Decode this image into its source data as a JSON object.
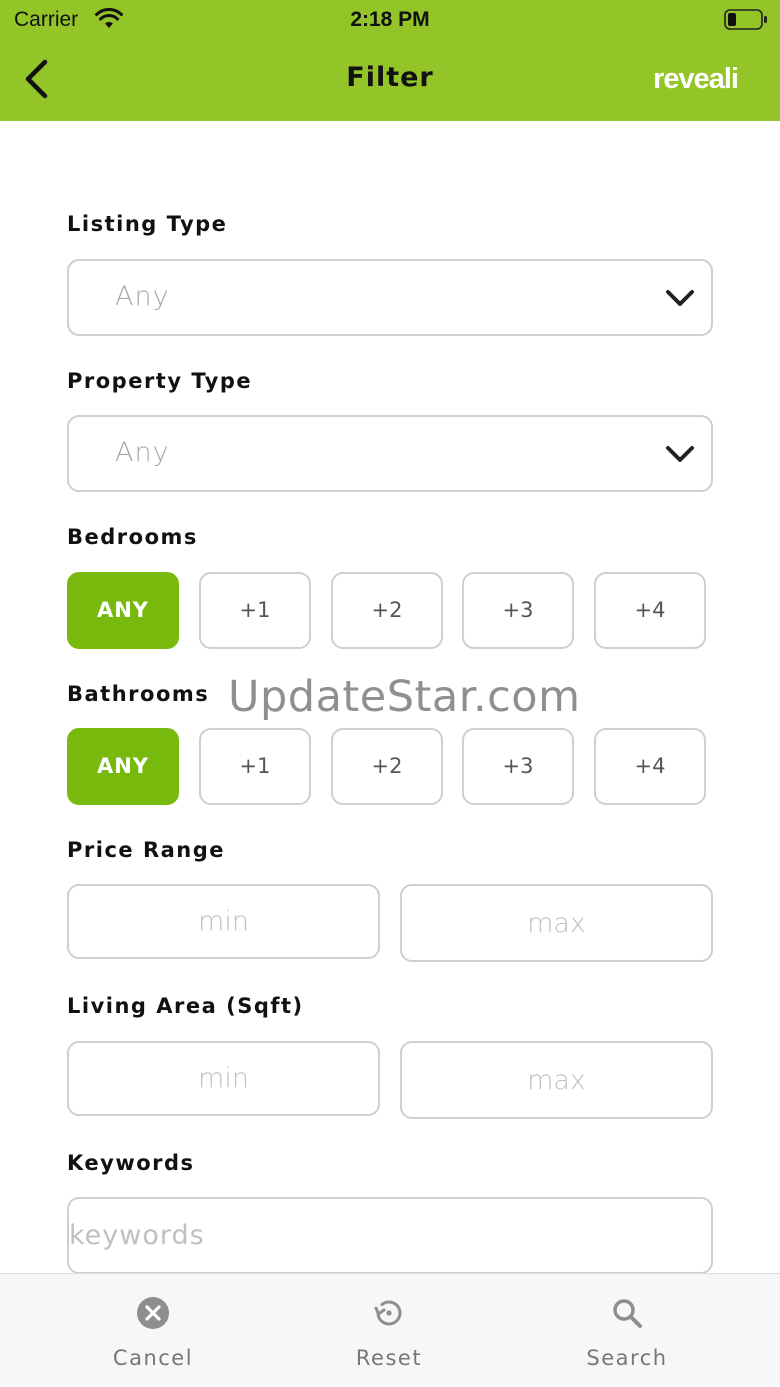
{
  "status_bar": {
    "carrier": "Carrier",
    "time": "2:18 PM"
  },
  "header": {
    "title": "Filter",
    "logo": "reveali",
    "back_icon": "chevron-left-icon"
  },
  "listing_type": {
    "label": "Listing Type",
    "value": "Any"
  },
  "property_type": {
    "label": "Property Type",
    "value": "Any"
  },
  "bedrooms": {
    "label": "Bedrooms",
    "options": [
      "ANY",
      "+1",
      "+2",
      "+3",
      "+4"
    ],
    "selected": "ANY"
  },
  "bathrooms": {
    "label": "Bathrooms",
    "options": [
      "ANY",
      "+1",
      "+2",
      "+3",
      "+4"
    ],
    "selected": "ANY"
  },
  "price_range": {
    "label": "Price Range",
    "min_placeholder": "min",
    "max_placeholder": "max"
  },
  "living_area": {
    "label": "Living Area (Sqft)",
    "min_placeholder": "min",
    "max_placeholder": "max"
  },
  "keywords": {
    "label": "Keywords",
    "placeholder": "keywords"
  },
  "watermark": "UpdateStar.com",
  "bottom_bar": {
    "cancel": "Cancel",
    "reset": "Reset",
    "search": "Search"
  },
  "colors": {
    "header_bg": "#93c528",
    "accent": "#78b90e"
  }
}
